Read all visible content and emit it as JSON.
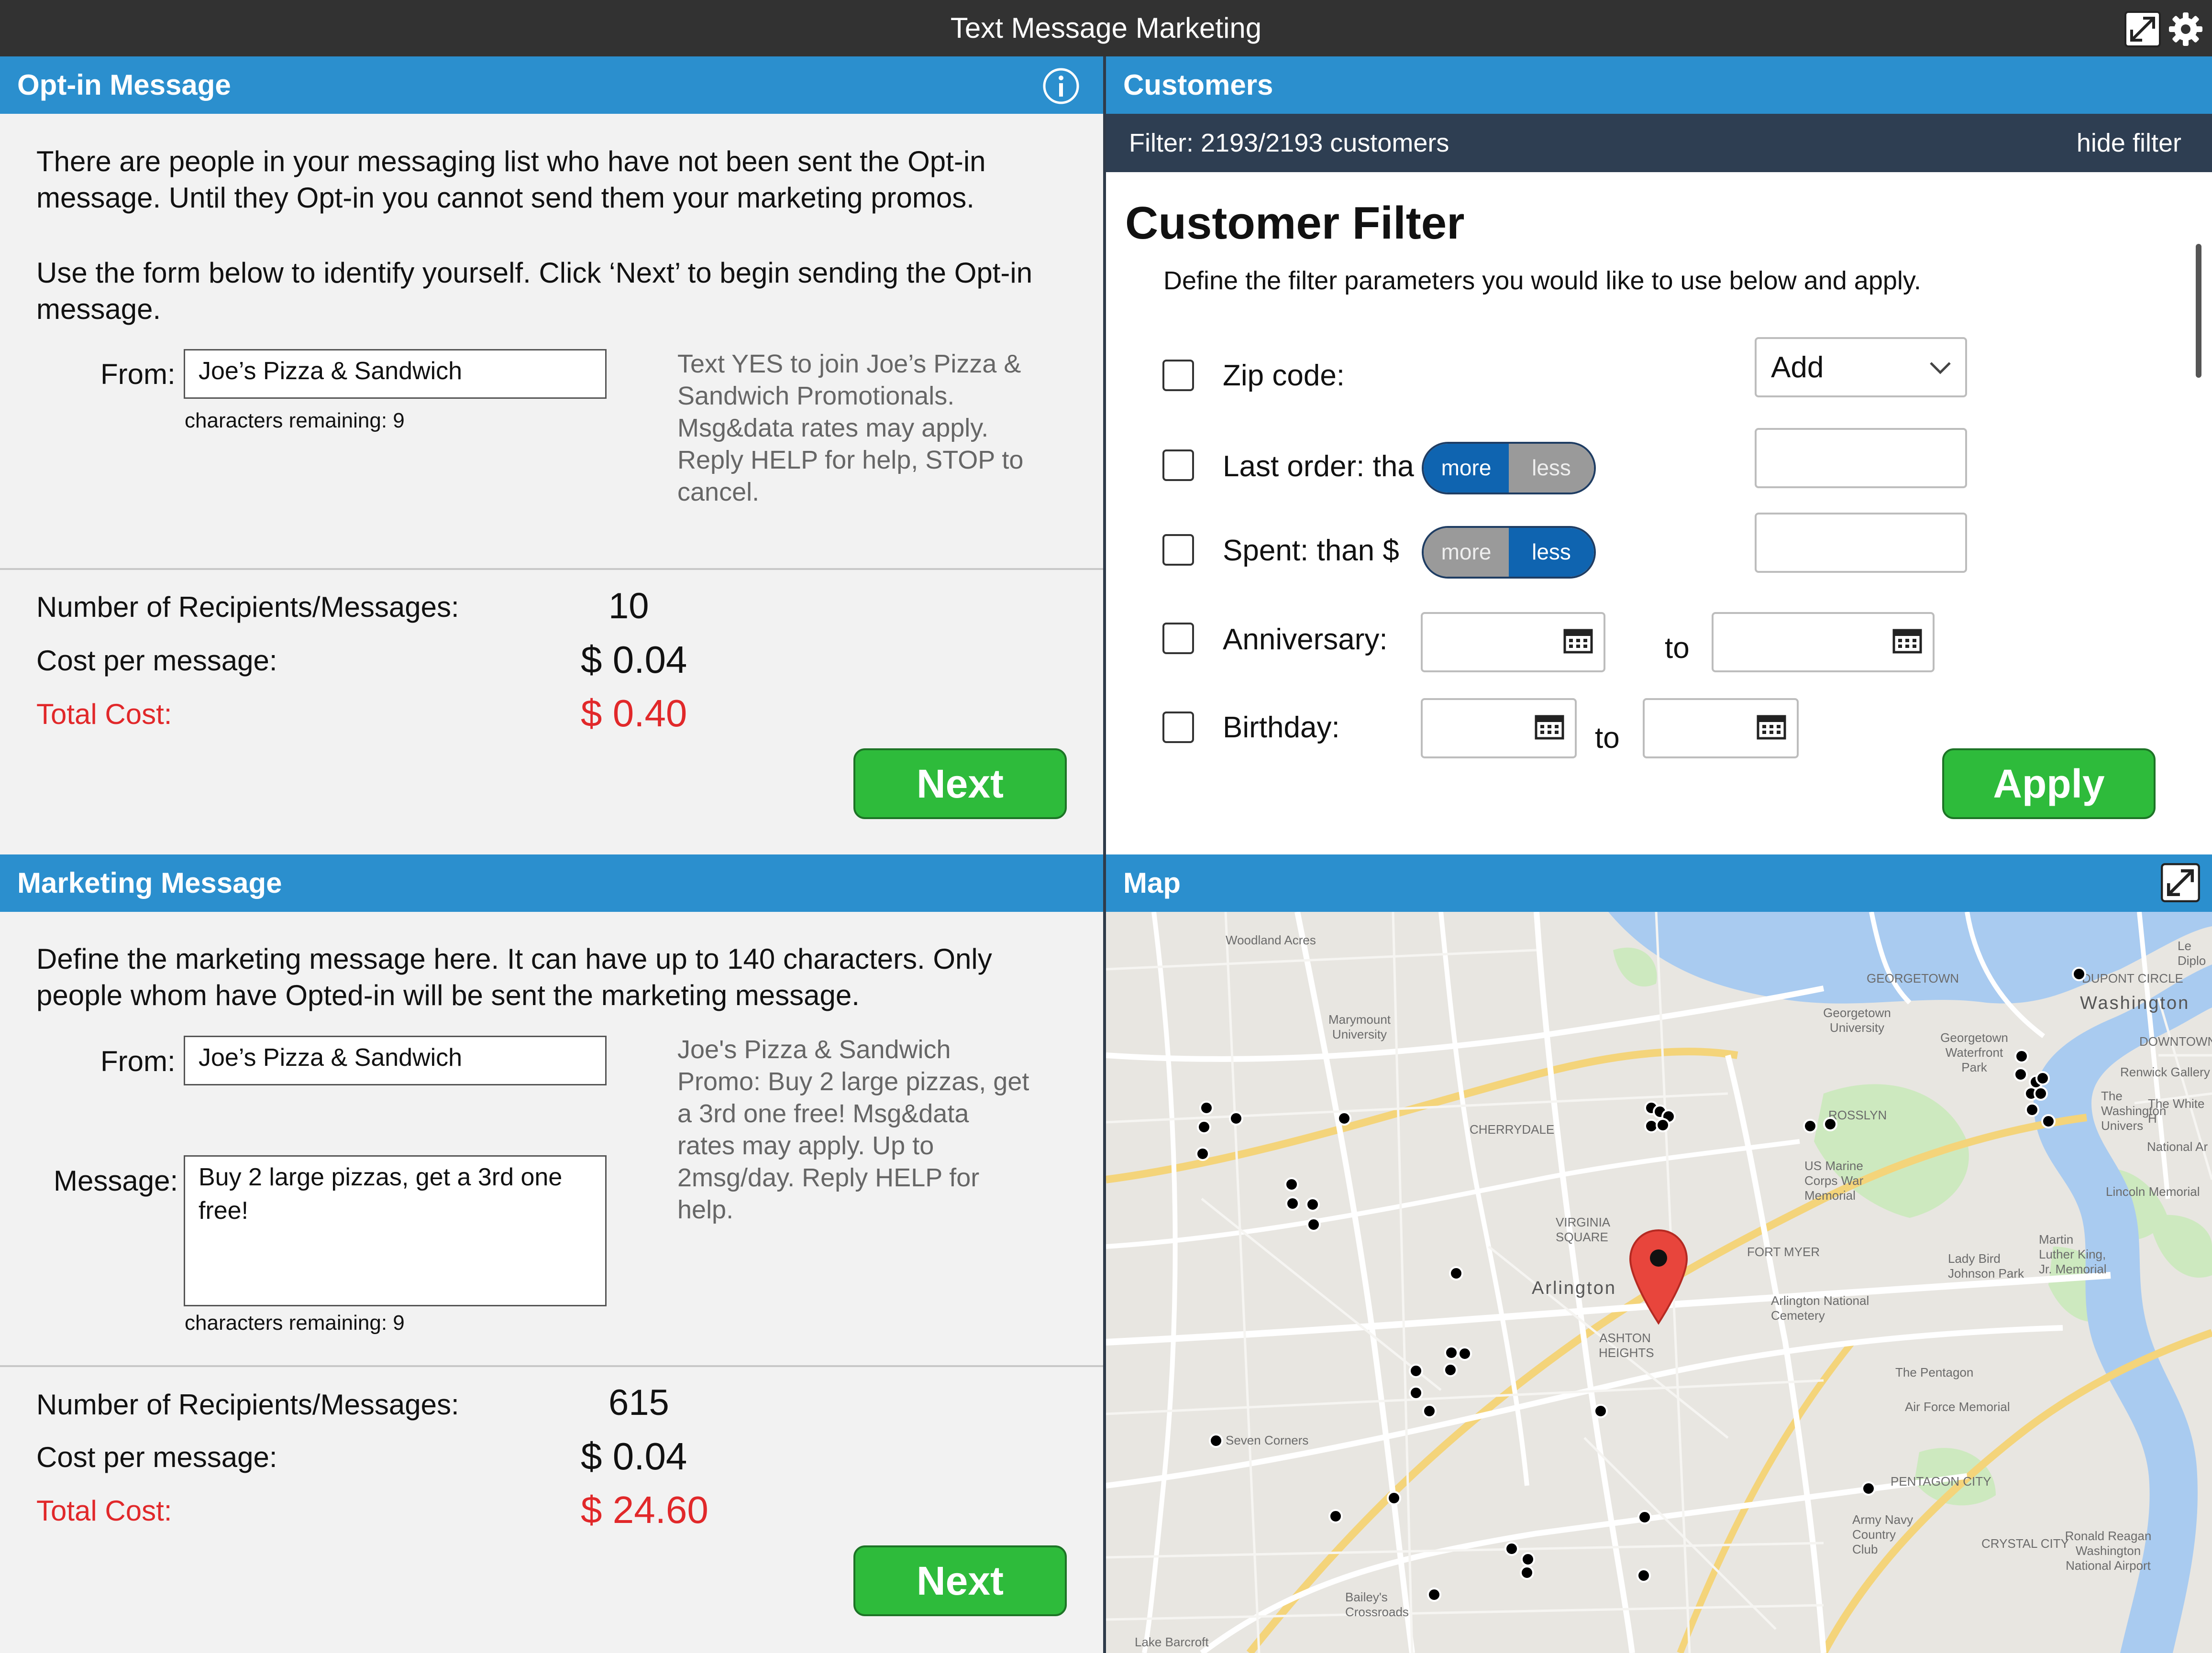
{
  "app": {
    "title": "Text Message Marketing"
  },
  "optin": {
    "header": "Opt-in Message",
    "intro": "There are people in your messaging list who have not been sent the Opt-in message. Until they Opt-in you cannot send them your marketing promos.",
    "instructions": "Use the form below to identify yourself. Click ‘Next’ to begin sending the Opt-in message.",
    "from_label": "From:",
    "from_value": "Joe’s Pizza & Sandwich",
    "chars_remaining": "characters remaining: 9",
    "preview": "Text YES to join Joe’s Pizza & Sandwich Promotionals. Msg&data rates may apply. Reply HELP for help, STOP to cancel.",
    "recipients_label": "Number of Recipients/Messages:",
    "recipients_value": "10",
    "cost_label": "Cost per message:",
    "cost_value": "$ 0.04",
    "total_label": "Total Cost:",
    "total_value": "$ 0.40",
    "next_label": "Next"
  },
  "marketing": {
    "header": "Marketing Message",
    "intro": "Define the marketing message here. It can have up to 140 characters. Only people whom have Opted-in will be sent the marketing message.",
    "from_label": "From:",
    "from_value": "Joe’s Pizza & Sandwich",
    "message_label": "Message:",
    "message_value": "Buy 2 large pizzas, get a 3rd one free!",
    "chars_remaining": "characters remaining: 9",
    "preview": "Joe's Pizza & Sandwich Promo: Buy 2 large pizzas, get a 3rd one free! Msg&data rates may apply. Up to 2msg/day. Reply HELP for help.",
    "recipients_label": "Number of Recipients/Messages:",
    "recipients_value": "615",
    "cost_label": "Cost per message:",
    "cost_value": "$ 0.04",
    "total_label": "Total Cost:",
    "total_value": "$ 24.60",
    "next_label": "Next"
  },
  "customers": {
    "header": "Customers",
    "filter_status": "Filter: 2193/2193 customers",
    "hide_filter": "hide filter",
    "filter_title": "Customer Filter",
    "filter_desc": "Define the filter parameters you would like to use below and apply.",
    "zip_label": "Zip code:",
    "zip_select": "Add",
    "last_order_label": "Last order: tha",
    "spent_label": "Spent: than $",
    "toggle_more": "more",
    "toggle_less": "less",
    "anniversary_label": "Anniversary:",
    "birthday_label": "Birthday:",
    "to_label": "to",
    "apply_label": "Apply"
  },
  "map": {
    "header": "Map",
    "labels": {
      "woodland_acres": "Woodland Acres",
      "marymount": "Marymount University",
      "georgetown": "GEORGETOWN",
      "georgetown_univ": "Georgetown University",
      "georgetown_waterfront": "Georgetown Waterfront Park",
      "dupont": "DUPONT CIRCLE",
      "washington": "Washington",
      "downtown": "DOWNTOWN",
      "renwick": "Renwick Gallery",
      "white_house": "The White H",
      "national_ar": "National Ar",
      "le_diplo": "Le Diplo",
      "cherrydale": "CHERRYDALE",
      "rosslyn": "ROSSLYN",
      "marine_corps": "US Marine Corps War Memorial",
      "lincoln": "Lincoln Memorial",
      "mlk": "Martin Luther King, Jr. Memorial",
      "virginia_square": "VIRGINIA SQUARE",
      "fort_myer": "FORT MYER",
      "lbj": "Lady Bird Johnson Park",
      "arlington": "Arlington",
      "arlington_cemetery": "Arlington National Cemetery",
      "ashton": "ASHTON HEIGHTS",
      "pentagon": "The Pentagon",
      "air_force": "Air Force Memorial",
      "seven_corners": "Seven Corners",
      "pentagon_city": "PENTAGON CITY",
      "army_navy": "Army Navy Country Club",
      "crystal_city": "CRYSTAL CITY",
      "reagan": "Ronald Reagan Washington National Airport",
      "baileys": "Bailey's Crossroads",
      "lake_barcroft": "Lake Barcroft",
      "the_wash": "The Washington Univers"
    }
  },
  "colors": {
    "titlebar": "#323232",
    "panel_header": "#2b8fce",
    "filter_bar": "#2e3e52",
    "button_green": "#2ebb3b",
    "total_red": "#e1282a",
    "toggle_blue": "#0f64b0",
    "map_water": "#a9cbf0",
    "map_park": "#cde9bf",
    "pin": "#e8453c"
  },
  "icons": [
    "expand-icon",
    "gear-icon",
    "info-icon",
    "chevron-down-icon",
    "calendar-icon",
    "map-pin-icon"
  ]
}
